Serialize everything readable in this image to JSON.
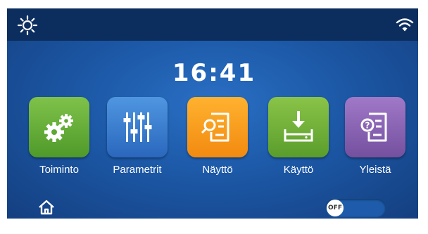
{
  "header": {
    "left_icon": "sun-icon",
    "right_icon": "wifi-icon"
  },
  "clock": {
    "time": "16:41"
  },
  "menu": {
    "items": [
      {
        "label": "Toiminto",
        "icon": "gears-icon",
        "color": "#5fa833"
      },
      {
        "label": "Parametrit",
        "icon": "sliders-icon",
        "color": "#3a7fd0"
      },
      {
        "label": "Näyttö",
        "icon": "document-search-icon",
        "color": "#f7a020"
      },
      {
        "label": "Käyttö",
        "icon": "download-icon",
        "color": "#6fb036"
      },
      {
        "label": "Yleistä",
        "icon": "document-help-icon",
        "color": "#8a64b4"
      }
    ]
  },
  "footer": {
    "home_icon": "home-icon",
    "toggle_label": "OFF"
  },
  "colors": {
    "topbar": "#0c2e5e",
    "background": "#1c58a6"
  }
}
